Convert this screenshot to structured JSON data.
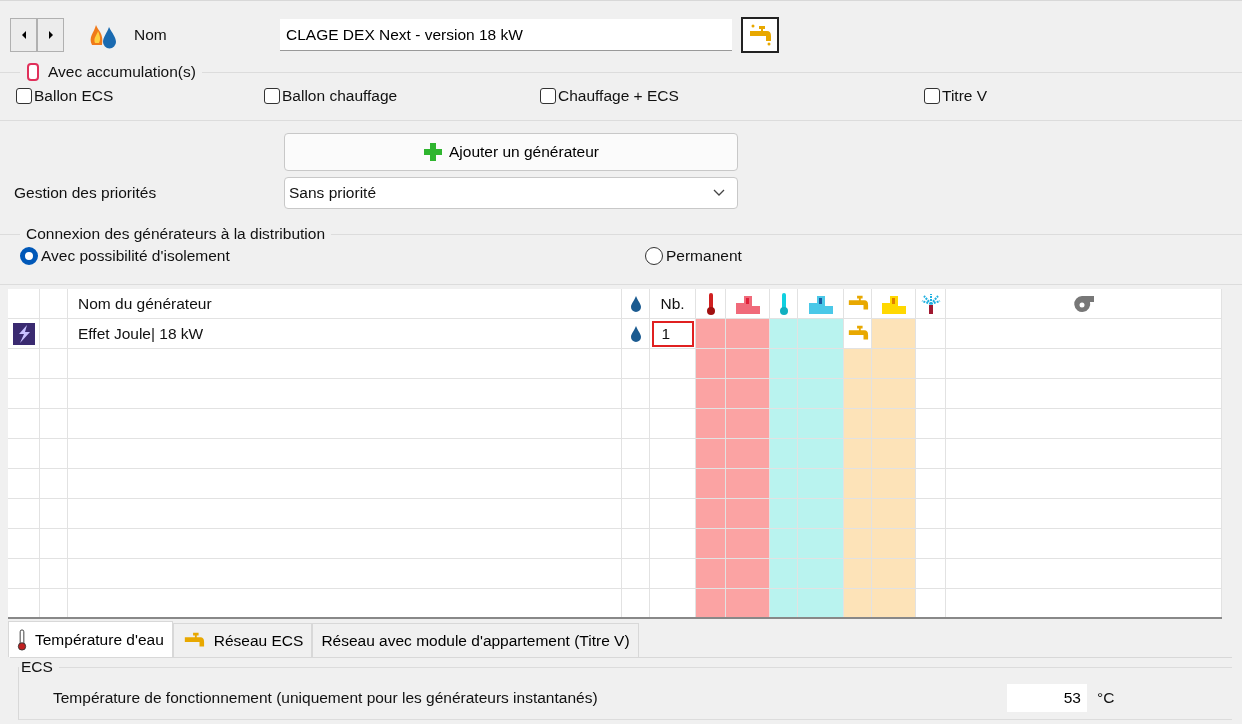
{
  "name": {
    "label": "Nom",
    "value": "CLAGE DEX Next - version 18 kW"
  },
  "accumulation": {
    "title": "Avec accumulation(s)",
    "options": [
      {
        "label": "Ballon ECS",
        "checked": false
      },
      {
        "label": "Ballon chauffage",
        "checked": false
      },
      {
        "label": "Chauffage + ECS",
        "checked": false
      },
      {
        "label": "Titre V",
        "checked": false
      }
    ]
  },
  "add_button": "Ajouter un générateur",
  "priority": {
    "label": "Gestion des priorités",
    "value": "Sans priorité"
  },
  "connection": {
    "title": "Connexion des générateurs à la distribution",
    "options": [
      {
        "label": "Avec possibilité d'isolement",
        "selected": true
      },
      {
        "label": "Permanent",
        "selected": false
      }
    ]
  },
  "grid": {
    "columns": [
      {
        "kind": "type"
      },
      {
        "kind": "blank"
      },
      {
        "kind": "name",
        "label": "Nom du générateur"
      },
      {
        "kind": "drop"
      },
      {
        "kind": "count",
        "label": "Nb."
      },
      {
        "kind": "thermo",
        "color": "#fba3a3"
      },
      {
        "kind": "podium",
        "color": "#fba3a3"
      },
      {
        "kind": "thermo",
        "color": "#b9f3ef"
      },
      {
        "kind": "podium",
        "color": "#b9f3ef"
      },
      {
        "kind": "tap",
        "color": "#fde3b8"
      },
      {
        "kind": "podium",
        "color": "#fde3b8"
      },
      {
        "kind": "spray"
      },
      {
        "kind": "fan"
      }
    ],
    "rows": [
      {
        "name": "Effet Joule| 18 kW",
        "count": "1",
        "tap": true
      }
    ]
  },
  "tabs": [
    {
      "label": "Température d'eau",
      "kind": "thermo",
      "selected": true
    },
    {
      "label": "Réseau ECS",
      "kind": "tap",
      "selected": false
    },
    {
      "label": "Réseau avec module d'appartement (Titre V)",
      "kind": "text",
      "selected": false
    }
  ],
  "ecs": {
    "title": "ECS",
    "label": "Température de fonctionnement (uniquement pour les générateurs instantanés)",
    "value": "53",
    "unit": "°C"
  }
}
